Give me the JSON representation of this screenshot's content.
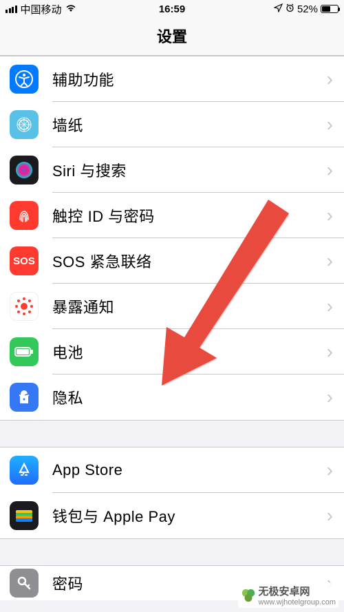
{
  "status": {
    "carrier": "中国移动",
    "time": "16:59",
    "battery_pct": "52%"
  },
  "nav": {
    "title": "设置"
  },
  "groups": [
    {
      "rows": [
        {
          "name": "accessibility",
          "label": "辅助功能",
          "icon": "accessibility-icon",
          "bg": "#007aff"
        },
        {
          "name": "wallpaper",
          "label": "墙纸",
          "icon": "wallpaper-icon",
          "bg": "#59c1e8"
        },
        {
          "name": "siri-search",
          "label": "Siri 与搜索",
          "icon": "siri-icon",
          "bg": "#1b1b1f"
        },
        {
          "name": "touchid-passcode",
          "label": "触控 ID 与密码",
          "icon": "touchid-icon",
          "bg": "#ff3b30"
        },
        {
          "name": "sos",
          "label": "SOS 紧急联络",
          "icon": "sos-icon",
          "bg": "#ff3b30"
        },
        {
          "name": "exposure",
          "label": "暴露通知",
          "icon": "exposure-icon",
          "bg": "#ffffff"
        },
        {
          "name": "battery",
          "label": "电池",
          "icon": "battery-icon",
          "bg": "#34c759"
        },
        {
          "name": "privacy",
          "label": "隐私",
          "icon": "privacy-icon",
          "bg": "#3478f6"
        }
      ]
    },
    {
      "rows": [
        {
          "name": "app-store",
          "label": "App Store",
          "icon": "appstore-icon",
          "bg": "#1e90ff"
        },
        {
          "name": "wallet",
          "label": "钱包与 Apple Pay",
          "icon": "wallet-icon",
          "bg": "#1b1b1f"
        }
      ]
    },
    {
      "rows": [
        {
          "name": "passwords",
          "label": "密码",
          "icon": "passwords-icon",
          "bg": "#8e8e93"
        }
      ]
    }
  ],
  "icons": {
    "sos_text": "SOS"
  },
  "watermark": {
    "title": "无极安卓网",
    "url": "www.wjhotelgroup.com"
  }
}
